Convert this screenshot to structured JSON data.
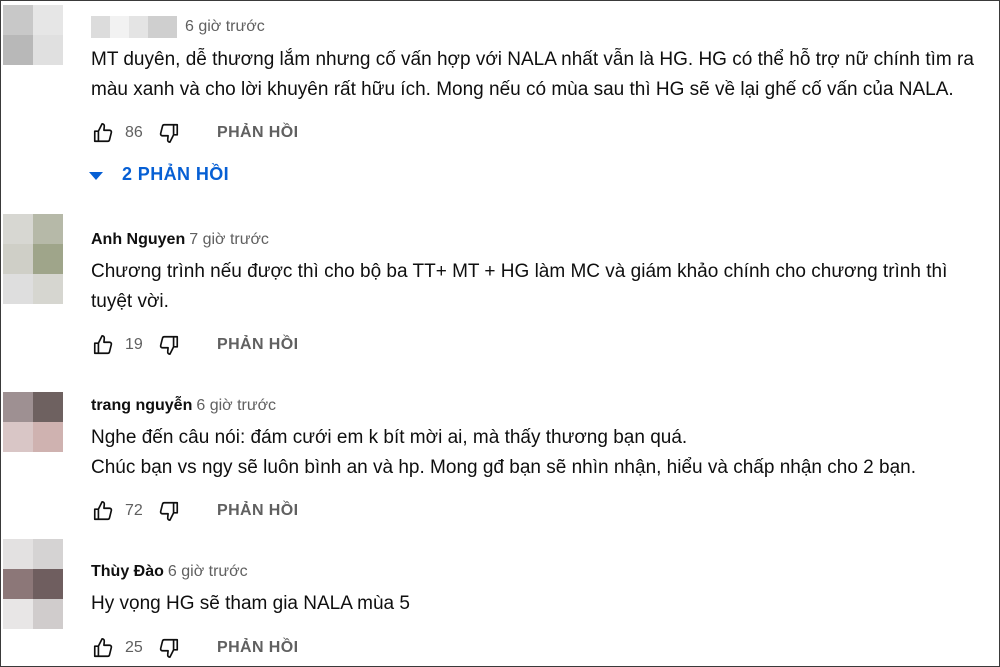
{
  "comments": [
    {
      "author": "",
      "time": "6 giờ trước",
      "text": "MT duyên, dễ thương lắm nhưng cố vấn hợp với NALA nhất vẫn là HG. HG có thể hỗ trợ nữ chính tìm ra\nmàu xanh và cho lời khuyên rất hữu ích. Mong nếu có mùa sau thì HG sẽ về lại ghế cố vấn của NALA.",
      "likes": "86",
      "reply_label": "PHẢN HỒI",
      "replies_toggle": "2 PHẢN HỒI",
      "avatar_colors": [
        "#c8c8c8",
        "#e6e6e6",
        "#b8b8b8",
        "#e0e0e0"
      ]
    },
    {
      "author": "Anh Nguyen",
      "time": "7 giờ trước",
      "text": "Chương trình nếu được thì cho bộ ba TT+ MT + HG làm MC và giám khảo chính cho chương trình thì\ntuyệt vời.",
      "likes": "19",
      "reply_label": "PHẢN HỒI",
      "avatar_colors": [
        "#d7d7d2",
        "#b6b9a8",
        "#cfcfc7",
        "#9fa58a",
        "#dedede",
        "#d6d6d0"
      ]
    },
    {
      "author": "trang nguyễn",
      "time": "6 giờ trước",
      "text": "Nghe đến câu nói: đám cưới em k bít mời ai, mà thấy thương bạn quá.\nChúc bạn vs ngy sẽ luôn bình an và hp. Mong gđ bạn sẽ nhìn nhận, hiểu và chấp nhận cho 2 bạn.",
      "likes": "72",
      "reply_label": "PHẢN HỒI",
      "avatar_colors": [
        "#9e9092",
        "#6e6160",
        "#d9c6c6",
        "#cfb2b0"
      ]
    },
    {
      "author": "Thùy Đào",
      "time": "6 giờ trước",
      "text": "Hy vọng HG sẽ tham gia NALA mùa 5",
      "likes": "25",
      "reply_label": "PHẢN HỒI",
      "avatar_colors": [
        "#e3e1e1",
        "#d5d3d3",
        "#8c7778",
        "#6f5e5f",
        "#e8e6e6",
        "#d0cccc"
      ]
    }
  ]
}
